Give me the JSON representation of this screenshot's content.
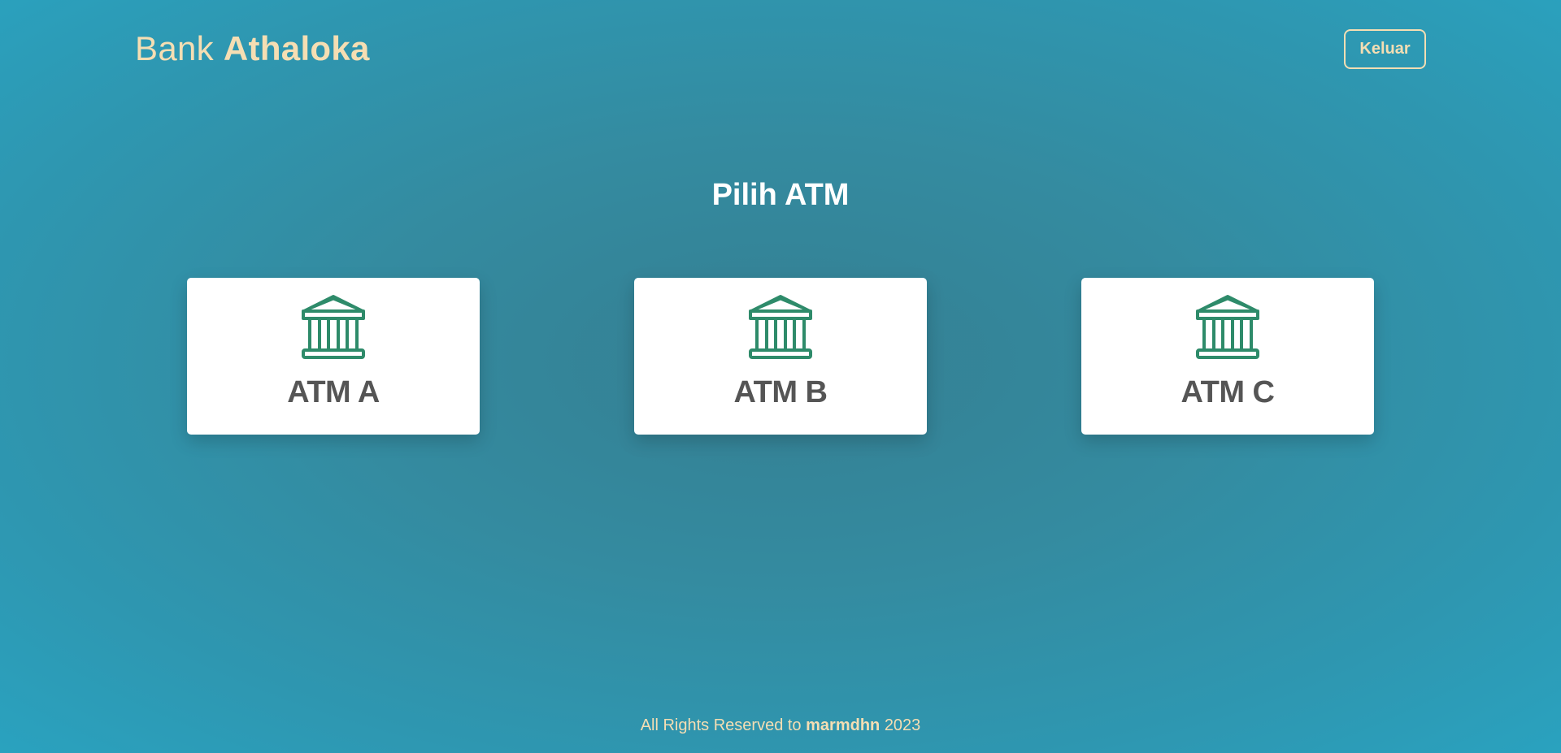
{
  "header": {
    "brand_prefix": "Bank",
    "brand_name": "Athaloka",
    "logout_label": "Keluar"
  },
  "main": {
    "title": "Pilih ATM",
    "atms": [
      {
        "label": "ATM A",
        "icon": "bank-icon"
      },
      {
        "label": "ATM B",
        "icon": "bank-icon"
      },
      {
        "label": "ATM C",
        "icon": "bank-icon"
      }
    ]
  },
  "footer": {
    "prefix": "All Rights Reserved to",
    "author": "marmdhn",
    "year": "2023"
  },
  "colors": {
    "accent": "#f5deb3",
    "icon": "#2e8b6a",
    "card_text": "#555555"
  }
}
